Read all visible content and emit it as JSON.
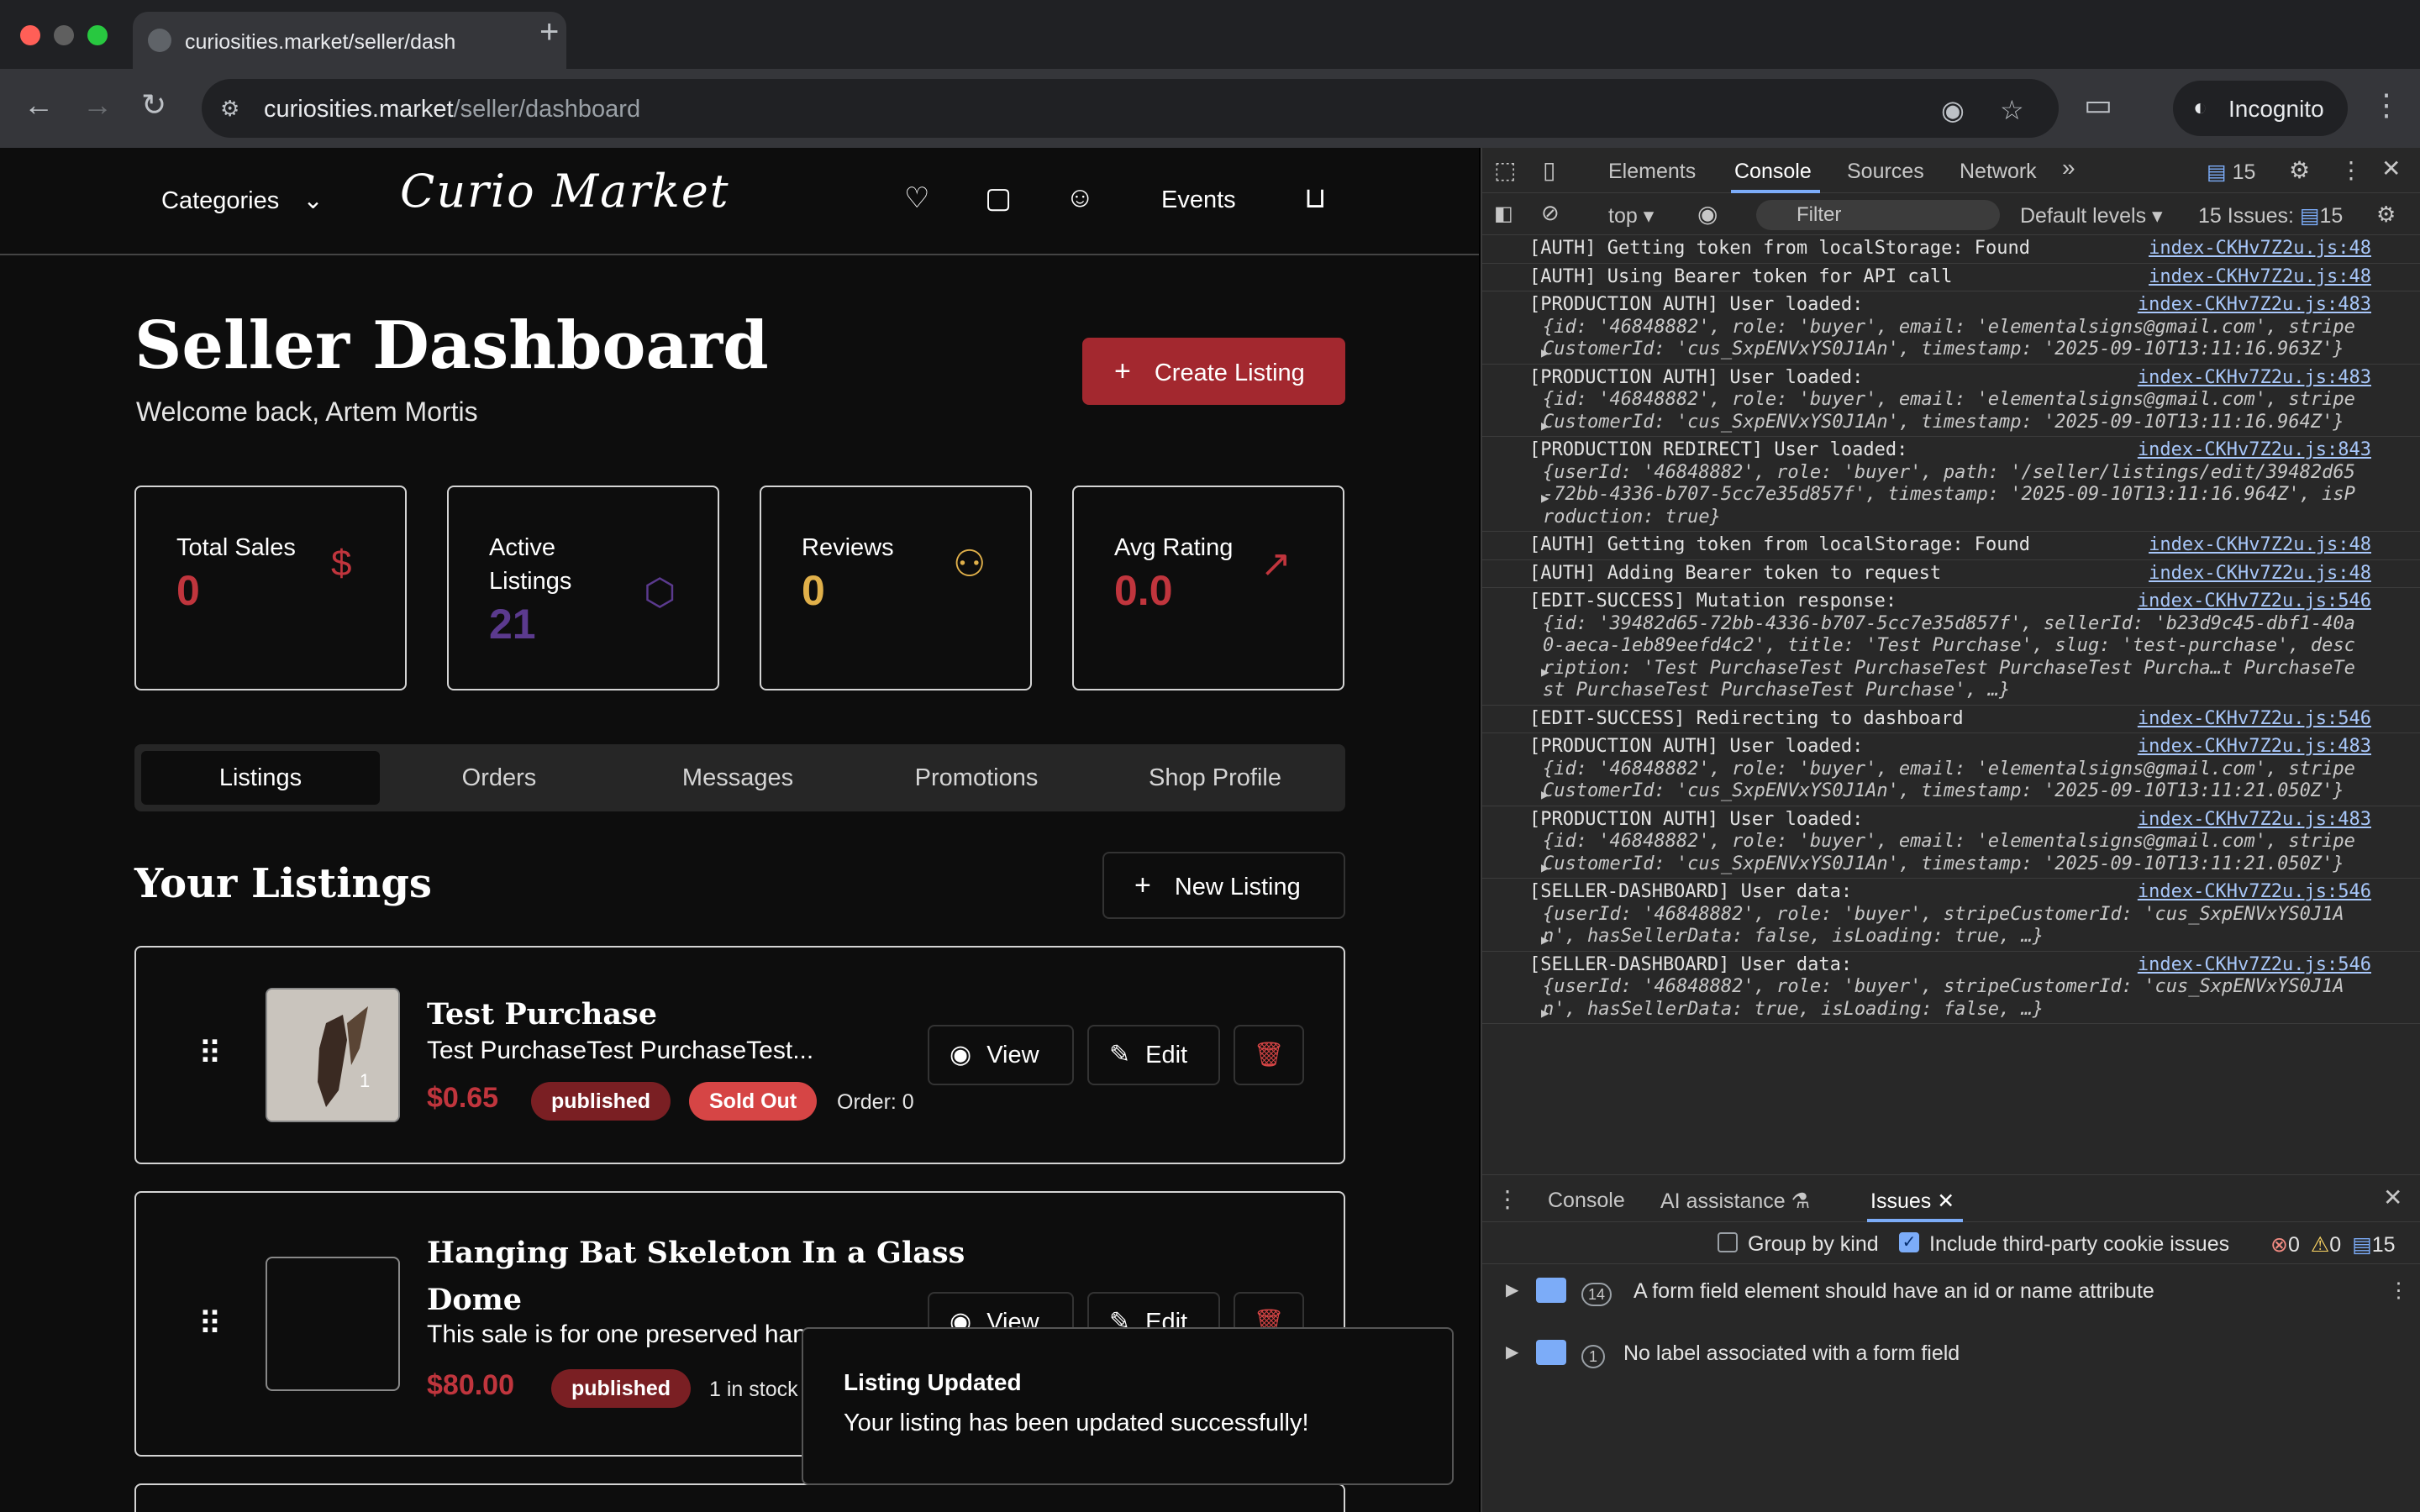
{
  "browser": {
    "tab_title": "curiosities.market/seller/dash",
    "url_host": "curiosities.market",
    "url_path": "/seller/dashboard",
    "incognito_label": "Incognito"
  },
  "site": {
    "categories_label": "Categories",
    "logo_text": "Curio Market",
    "events_label": "Events"
  },
  "dashboard": {
    "title": "Seller Dashboard",
    "welcome": "Welcome back, Artem Mortis",
    "create_listing_label": "Create Listing",
    "stats": [
      {
        "label": "Total Sales",
        "value": "0",
        "color": "#c0353d",
        "icon": "dollar-icon"
      },
      {
        "label": "Active Listings",
        "value": "21",
        "color": "#5b3a8e",
        "icon": "package-icon"
      },
      {
        "label": "Reviews",
        "value": "0",
        "color": "#e0b04a",
        "icon": "users-icon"
      },
      {
        "label": "Avg Rating",
        "value": "0.0",
        "color": "#c0353d",
        "icon": "trending-up-icon"
      }
    ],
    "tabs": [
      "Listings",
      "Orders",
      "Messages",
      "Promotions",
      "Shop Profile"
    ],
    "active_tab": "Listings",
    "listings_heading": "Your Listings",
    "new_listing_label": "New Listing",
    "listings": [
      {
        "title": "Test Purchase",
        "description": "Test PurchaseTest PurchaseTest...",
        "price": "$0.65",
        "status": "published",
        "stock_badge": "Sold Out",
        "order": "Order: 0",
        "thumb_badge": "1"
      },
      {
        "title_line1": "Hanging Bat Skeleton In a Glass",
        "title_line2": "Dome",
        "description": "This sale is for one preserved han",
        "price": "$80.00",
        "status": "published",
        "stock": "1 in stock"
      }
    ],
    "view_label": "View",
    "edit_label": "Edit"
  },
  "toast": {
    "title": "Listing Updated",
    "message": "Your listing has been updated successfully!"
  },
  "devtools": {
    "tabs": [
      "Elements",
      "Console",
      "Sources",
      "Network"
    ],
    "active_tab": "Console",
    "issue_badge": "15",
    "context": "top",
    "filter_placeholder": "Filter",
    "levels": "Default levels",
    "issues_label": "15 Issues:",
    "issues_count": "15",
    "logs": [
      {
        "text": "[AUTH] Getting token from localStorage: Found",
        "src": "index-CKHv7Z2u.js:48"
      },
      {
        "text": "[AUTH] Using Bearer token for API call",
        "src": "index-CKHv7Z2u.js:48"
      },
      {
        "text": "[PRODUCTION AUTH] User loaded:",
        "src": "index-CKHv7Z2u.js:483",
        "obj": [
          "{id: '46848882', role: 'buyer', email: 'elementalsigns@gmail.com', stripe",
          "CustomerId: 'cus_SxpENVxYS0J1An', timestamp: '2025-09-10T13:11:16.963Z'}"
        ]
      },
      {
        "text": "[PRODUCTION AUTH] User loaded:",
        "src": "index-CKHv7Z2u.js:483",
        "obj": [
          "{id: '46848882', role: 'buyer', email: 'elementalsigns@gmail.com', stripe",
          "CustomerId: 'cus_SxpENVxYS0J1An', timestamp: '2025-09-10T13:11:16.964Z'}"
        ]
      },
      {
        "text": "[PRODUCTION REDIRECT] User loaded:",
        "src": "index-CKHv7Z2u.js:843",
        "obj": [
          "{userId: '46848882', role: 'buyer', path: '/seller/listings/edit/39482d65",
          "-72bb-4336-b707-5cc7e35d857f', timestamp: '2025-09-10T13:11:16.964Z', isP",
          "roduction: true}"
        ]
      },
      {
        "text": "[AUTH] Getting token from localStorage: Found",
        "src": "index-CKHv7Z2u.js:48"
      },
      {
        "text": "[AUTH] Adding Bearer token to request",
        "src": "index-CKHv7Z2u.js:48"
      },
      {
        "text": "[EDIT-SUCCESS] Mutation response:",
        "src": "index-CKHv7Z2u.js:546",
        "obj": [
          "{id: '39482d65-72bb-4336-b707-5cc7e35d857f', sellerId: 'b23d9c45-dbf1-40a",
          "0-aeca-1eb89eefd4c2', title: 'Test Purchase', slug: 'test-purchase', desc",
          "ription: 'Test PurchaseTest PurchaseTest PurchaseTest Purcha…t PurchaseTe",
          "st PurchaseTest PurchaseTest Purchase', …}"
        ]
      },
      {
        "text": "[EDIT-SUCCESS] Redirecting to dashboard",
        "src": "index-CKHv7Z2u.js:546"
      },
      {
        "text": "[PRODUCTION AUTH] User loaded:",
        "src": "index-CKHv7Z2u.js:483",
        "obj": [
          "{id: '46848882', role: 'buyer', email: 'elementalsigns@gmail.com', stripe",
          "CustomerId: 'cus_SxpENVxYS0J1An', timestamp: '2025-09-10T13:11:21.050Z'}"
        ]
      },
      {
        "text": "[PRODUCTION AUTH] User loaded:",
        "src": "index-CKHv7Z2u.js:483",
        "obj": [
          "{id: '46848882', role: 'buyer', email: 'elementalsigns@gmail.com', stripe",
          "CustomerId: 'cus_SxpENVxYS0J1An', timestamp: '2025-09-10T13:11:21.050Z'}"
        ]
      },
      {
        "text": "[SELLER-DASHBOARD] User data:",
        "src": "index-CKHv7Z2u.js:546",
        "obj": [
          "{userId: '46848882', role: 'buyer', stripeCustomerId: 'cus_SxpENVxYS0J1A",
          "n', hasSellerData: false, isLoading: true, …}"
        ]
      },
      {
        "text": "[SELLER-DASHBOARD] User data:",
        "src": "index-CKHv7Z2u.js:546",
        "obj": [
          "{userId: '46848882', role: 'buyer', stripeCustomerId: 'cus_SxpENVxYS0J1A",
          "n', hasSellerData: true, isLoading: false, …}"
        ]
      }
    ],
    "drawer_tabs": [
      "Console",
      "AI assistance",
      "Issues"
    ],
    "drawer_active": "Issues",
    "group_by_kind": "Group by kind",
    "include_third_party": "Include third-party cookie issues",
    "err_count": "0",
    "warn_count": "0",
    "info_count": "15",
    "issues": [
      {
        "count": "14",
        "text": "A form field element should have an id or name attribute"
      },
      {
        "count": "1",
        "text": "No label associated with a form field"
      }
    ]
  }
}
